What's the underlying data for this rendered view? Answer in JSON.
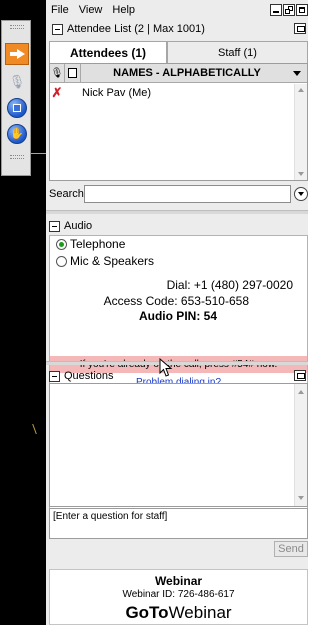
{
  "menu": {
    "file": "File",
    "view": "View",
    "help": "Help"
  },
  "attendee_list": {
    "header": "Attendee List",
    "count_info": "(2 | Max 1001)",
    "tabs": [
      {
        "label": "Attendees (1)",
        "active": true
      },
      {
        "label": "Staff (1)",
        "active": false
      }
    ],
    "column_sort": "NAMES - ALPHABETICALLY",
    "rows": [
      {
        "name": "Nick Pav (Me)",
        "mic": "muted"
      }
    ],
    "search_label": "Search",
    "search_value": ""
  },
  "audio": {
    "header": "Audio",
    "options": [
      {
        "label": "Telephone",
        "selected": true
      },
      {
        "label": "Mic & Speakers",
        "selected": false
      }
    ],
    "dial": "Dial: +1 (480) 297-0020",
    "access_code": "Access Code: 653-510-658",
    "audio_pin": "Audio PIN: 54",
    "notice": "If you're already on the call, press #54# now.",
    "problem_link": "Problem dialing in?"
  },
  "questions": {
    "header": "Questions",
    "input_placeholder": "[Enter a question for staff]",
    "send_label": "Send"
  },
  "footer": {
    "title": "Webinar",
    "webinar_id": "Webinar ID: 726-486-617",
    "brand_bold": "GoTo",
    "brand_regular": "Webinar"
  },
  "colors": {
    "accent_orange": "#f08a24",
    "notice_bg": "#f4b8b8",
    "link_blue": "#1a3cc8",
    "radio_green": "#1a9c1a",
    "mute_red": "#d0202a"
  }
}
